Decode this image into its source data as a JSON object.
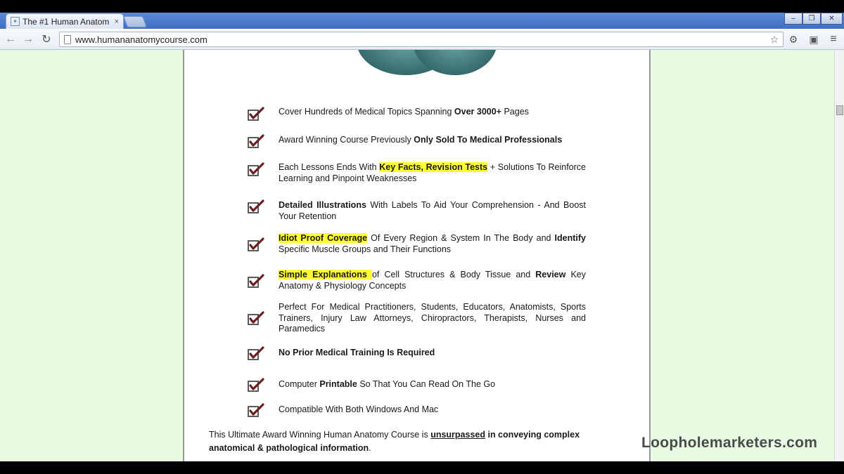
{
  "browser": {
    "tab_title": "The #1 Human Anatom",
    "tab_close": "×",
    "url": "www.humananatomycourse.com",
    "win_min": "–",
    "win_max": "❐",
    "win_close": "✕"
  },
  "features": [
    {
      "parts": [
        {
          "t": "Cover Hundreds of Medical Topics Spanning "
        },
        {
          "t": "Over 3000+",
          "s": "b"
        },
        {
          "t": " Pages"
        }
      ]
    },
    {
      "parts": [
        {
          "t": "Award Winning Course Previously "
        },
        {
          "t": "Only Sold To Medical Professionals",
          "s": "b"
        }
      ]
    },
    {
      "parts": [
        {
          "t": "Each Lessons Ends With "
        },
        {
          "t": "Key Facts, Revision Tests",
          "s": "hl"
        },
        {
          "t": " + Solutions To Reinforce Learning and Pinpoint Weaknesses"
        }
      ]
    },
    {
      "parts": [
        {
          "t": "Detailed Illustrations",
          "s": "b"
        },
        {
          "t": " With Labels To Aid Your Comprehension - And Boost Your Retention"
        }
      ]
    },
    {
      "parts": [
        {
          "t": "Idiot Proof Coverage",
          "s": "hl"
        },
        {
          "t": " Of Every Region & System In The Body and "
        },
        {
          "t": "Identify",
          "s": "b"
        },
        {
          "t": " Specific Muscle Groups and Their Functions"
        }
      ]
    },
    {
      "parts": [
        {
          "t": "Simple Explanations ",
          "s": "hl"
        },
        {
          "t": "of Cell Structures & Body Tissue and "
        },
        {
          "t": "Review",
          "s": "b"
        },
        {
          "t": " Key Anatomy & Physiology Concepts"
        }
      ]
    },
    {
      "parts": [
        {
          "t": "Perfect For Medical Practitioners, Students, Educators, Anatomists, Sports Trainers, Injury Law Attorneys, Chiropractors, Therapists, Nurses and Paramedics"
        }
      ]
    },
    {
      "parts": [
        {
          "t": "No Prior Medical Training Is Required",
          "s": "b"
        }
      ]
    },
    {
      "parts": [
        {
          "t": "Computer "
        },
        {
          "t": "Printable",
          "s": "b"
        },
        {
          "t": " So That You Can Read On The Go"
        }
      ]
    },
    {
      "parts": [
        {
          "t": "Compatible With Both Windows And Mac"
        }
      ]
    }
  ],
  "footer": {
    "pre": "This Ultimate Award Winning Human Anatomy Course is ",
    "underlined": "unsurpassed",
    "post_bold": " in conveying complex anatomical & pathological information",
    "post": "."
  },
  "watermark": "Loopholemarketers.com"
}
